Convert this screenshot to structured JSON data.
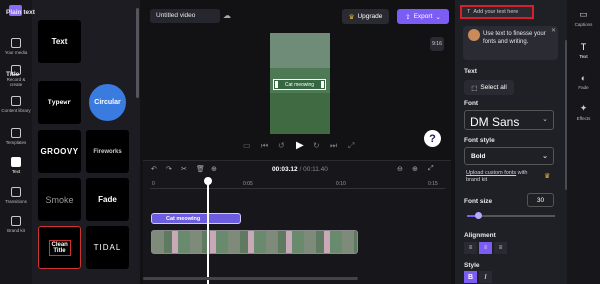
{
  "nav": [
    {
      "label": "Your media",
      "icon": "folder-icon"
    },
    {
      "label": "Record & create",
      "icon": "camera-icon"
    },
    {
      "label": "Content library",
      "icon": "library-icon"
    },
    {
      "label": "Templates",
      "icon": "templates-icon"
    },
    {
      "label": "Text",
      "icon": "text-icon",
      "active": true
    },
    {
      "label": "Transitions",
      "icon": "transitions-icon"
    },
    {
      "label": "Brand kit",
      "icon": "brand-kit-icon"
    }
  ],
  "panel": {
    "plain_text_title": "Plain text",
    "plain_tile": "Text",
    "title_section": "Title",
    "tiles": [
      "Typewr",
      "Circular",
      "GROOVY",
      "Fireworks",
      "Smoke",
      "Fade",
      "Clean Title",
      "TIDAL"
    ]
  },
  "topbar": {
    "video_title": "Untitled video",
    "upgrade_label": "Upgrade",
    "export_label": "Export"
  },
  "preview": {
    "overlay_text": "Cat meowing",
    "aspect_ratio": "9:16",
    "help": "?"
  },
  "timeline": {
    "current_time": "00:03.12",
    "total_time": "/ 00:11.40",
    "ticks": [
      "0",
      "0:05",
      "0:10",
      "0:15"
    ],
    "text_clip_label": "Cat meowing"
  },
  "props": {
    "add_text_placeholder": "Add your text here",
    "tip_text": "Use text to finesse your fonts and writing.",
    "text_section": "Text",
    "select_all_label": "Select all",
    "font_section": "Font",
    "font_value": "DM Sans",
    "font_style_section": "Font style",
    "font_style_value": "Bold",
    "upload_link": "Upload custom fonts",
    "upload_suffix": " with brand kit",
    "font_size_section": "Font size",
    "font_size_value": "30",
    "font_size_fraction": 0.13,
    "alignment_section": "Alignment",
    "style_section": "Style"
  },
  "rail": [
    {
      "label": "Captions",
      "icon": "captions-icon"
    },
    {
      "label": "Text",
      "icon": "text-icon",
      "active": true
    },
    {
      "label": "Fade",
      "icon": "fade-icon"
    },
    {
      "label": "Effects",
      "icon": "effects-icon"
    }
  ],
  "colors": {
    "accent": "#7b5cf5",
    "highlight_box": "#d8202a"
  }
}
